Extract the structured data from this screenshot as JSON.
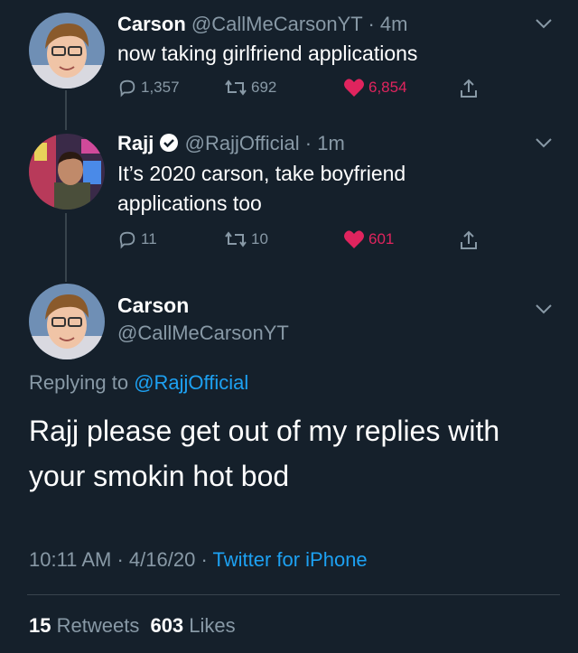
{
  "tweet1": {
    "name": "Carson",
    "handle_time": "@CallMeCarsonYT · 4m",
    "text": "now taking girlfriend applications",
    "replies": "1,357",
    "retweets": "692",
    "likes": "6,854"
  },
  "tweet2": {
    "name": "Rajj",
    "handle_time": "@RajjOfficial · 1m",
    "text": "It’s 2020 carson, take boyfriend applications too",
    "replies": "11",
    "retweets": "10",
    "likes": "601"
  },
  "main": {
    "name": "Carson",
    "handle": "@CallMeCarsonYT",
    "replying_prefix": "Replying to",
    "replying_to": "@RajjOfficial",
    "text": "Rajj please get out of my replies with your smokin hot bod",
    "time": "10:11 AM",
    "date": "4/16/20",
    "client": "Twitter for iPhone",
    "retweets_count": "15",
    "retweets_label": "Retweets",
    "likes_count": "603",
    "likes_label": "Likes"
  },
  "colors": {
    "background": "#15202b",
    "secondary_text": "#8899a6",
    "link": "#1da1f2",
    "like": "#e0245e"
  },
  "icons": [
    "reply-icon",
    "retweet-icon",
    "heart-icon",
    "share-icon",
    "chevron-down-icon",
    "verified-badge-icon"
  ]
}
